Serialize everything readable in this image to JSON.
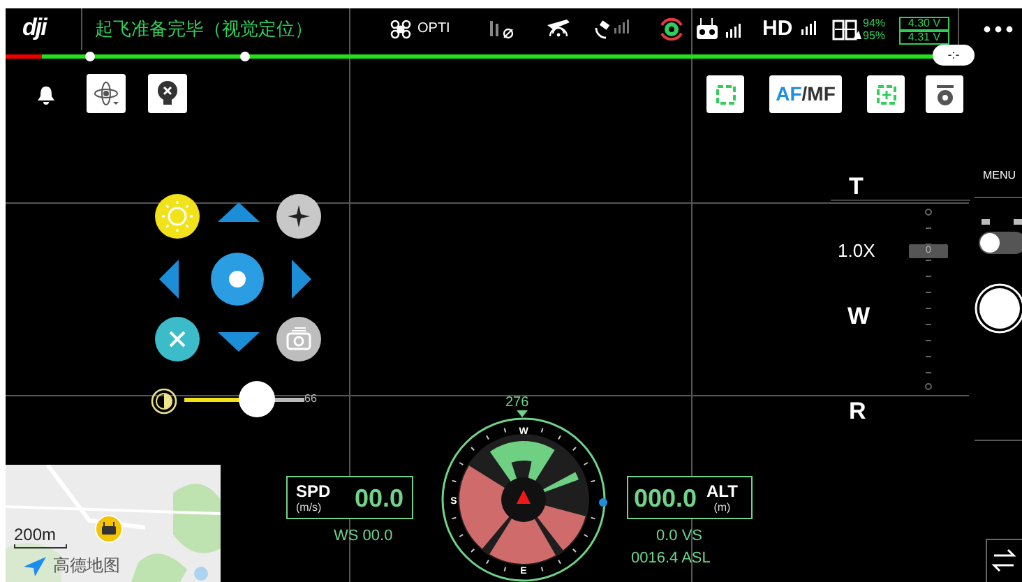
{
  "status_bar": {
    "logo": "dji",
    "status_text": "起飞准备完毕（视觉定位）",
    "flight_mode": "OPTI",
    "video_link": "HD",
    "battery_percents": [
      "94%",
      "95%"
    ],
    "cell_voltages": [
      "4.30 V",
      "4.31 V"
    ],
    "timer_bubble": "-:-"
  },
  "camera_tools": {
    "focus_af": "AF",
    "focus_mf": "/MF"
  },
  "zoom": {
    "tele": "T",
    "factor": "1.0X",
    "wide": "W",
    "reset": "R",
    "slider_value": "0"
  },
  "menu": {
    "label": "MENU",
    "video_mode": false
  },
  "exposure": {
    "level": 0.6,
    "reading": "66"
  },
  "telemetry": {
    "speed": {
      "label": "SPD",
      "unit": "(m/s)",
      "value": "00.0"
    },
    "wind": "WS 00.0",
    "altitude": {
      "label": "ALT",
      "unit": "(m)",
      "value": "000.0"
    },
    "vertical_speed": "0.0 VS",
    "asl": "0016.4 ASL"
  },
  "compass": {
    "heading": "276",
    "labels": [
      "W",
      "S",
      "E"
    ]
  },
  "map": {
    "scale": "200m",
    "attribution": "高德地图"
  }
}
